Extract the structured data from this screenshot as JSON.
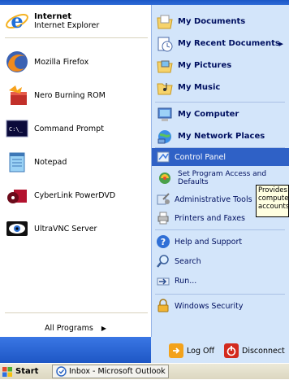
{
  "pinned": [
    {
      "title": "Internet",
      "subtitle": "Internet Explorer",
      "icon": "internet-explorer-icon"
    },
    {
      "title": "Mozilla Firefox",
      "icon": "firefox-icon"
    },
    {
      "title": "Nero Burning ROM",
      "icon": "nero-icon"
    },
    {
      "title": "Command Prompt",
      "icon": "command-prompt-icon"
    },
    {
      "title": "Notepad",
      "icon": "notepad-icon"
    },
    {
      "title": "CyberLink PowerDVD",
      "icon": "powerdvd-icon"
    },
    {
      "title": "UltraVNC Server",
      "icon": "ultravnc-icon"
    }
  ],
  "all_programs": {
    "label": "All Programs",
    "arrow": "▶"
  },
  "places": [
    {
      "label": "My Documents",
      "icon": "my-documents-icon"
    },
    {
      "label": "My Recent Documents",
      "icon": "my-recent-documents-icon",
      "arrow": "▶"
    },
    {
      "label": "My Pictures",
      "icon": "my-pictures-icon"
    },
    {
      "label": "My Music",
      "icon": "my-music-icon"
    },
    {
      "label": "My Computer",
      "icon": "my-computer-icon"
    },
    {
      "label": "My Network Places",
      "icon": "my-network-places-icon"
    }
  ],
  "system": [
    {
      "label": "Control Panel",
      "icon": "control-panel-icon"
    },
    {
      "label_line1": "Set Program Access and",
      "label_line2": "Defaults",
      "icon": "set-program-access-icon"
    },
    {
      "label": "Administrative Tools",
      "icon": "administrative-tools-icon"
    },
    {
      "label": "Printers and Faxes",
      "icon": "printers-faxes-icon"
    },
    {
      "label": "Help and Support",
      "icon": "help-support-icon"
    },
    {
      "label": "Search",
      "icon": "search-icon"
    },
    {
      "label": "Run...",
      "icon": "run-icon"
    },
    {
      "label": "Windows Security",
      "icon": "windows-security-icon"
    }
  ],
  "tooltip": {
    "line1": "Provides",
    "line2": "compute",
    "line3": "accounts"
  },
  "footer": {
    "log_off": "Log Off",
    "disconnect": "Disconnect"
  },
  "taskbar": {
    "start": "Start",
    "task": "Inbox - Microsoft Outlook"
  },
  "colors": {
    "highlight": "#2f61c6",
    "right_pane": "#d3e5fa",
    "footer": "#2a66d6"
  }
}
